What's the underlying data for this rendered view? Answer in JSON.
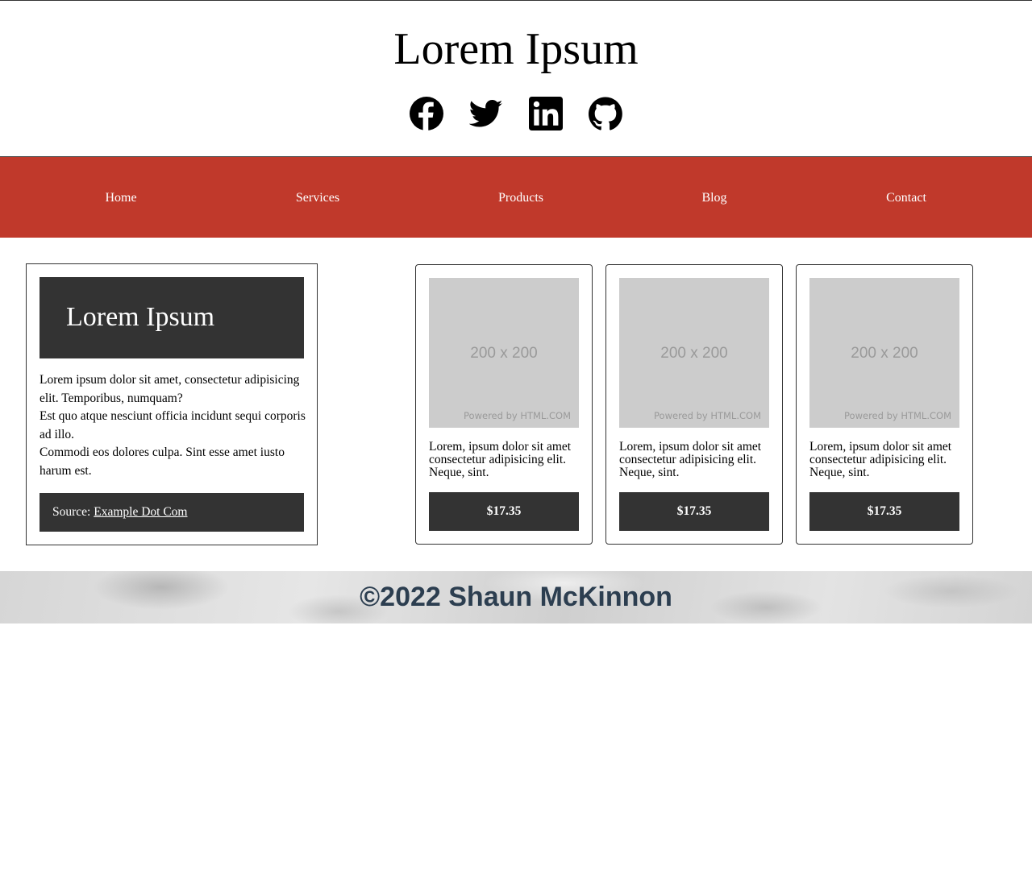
{
  "header": {
    "title": "Lorem Ipsum",
    "social": [
      {
        "name": "facebook-icon"
      },
      {
        "name": "twitter-icon"
      },
      {
        "name": "linkedin-icon"
      },
      {
        "name": "github-icon"
      }
    ]
  },
  "nav": {
    "items": [
      "Home",
      "Services",
      "Products",
      "Blog",
      "Contact"
    ]
  },
  "feature": {
    "title": "Lorem Ipsum",
    "paragraphs": [
      "Lorem ipsum dolor sit amet, consectetur adipisicing elit. Temporibus, numquam?",
      "Est quo atque nesciunt officia incidunt sequi corporis ad illo.",
      "Commodi eos dolores culpa. Sint esse amet iusto harum est."
    ],
    "source_prefix": "Source:",
    "source_link": "Example Dot Com"
  },
  "products": [
    {
      "image_label": "200 x 200",
      "image_credit": "Powered by HTML.COM",
      "description": "Lorem, ipsum dolor sit amet consectetur adipisicing elit. Neque, sint.",
      "price": "$17.35"
    },
    {
      "image_label": "200 x 200",
      "image_credit": "Powered by HTML.COM",
      "description": "Lorem, ipsum dolor sit amet consectetur adipisicing elit. Neque, sint.",
      "price": "$17.35"
    },
    {
      "image_label": "200 x 200",
      "image_credit": "Powered by HTML.COM",
      "description": "Lorem, ipsum dolor sit amet consectetur adipisicing elit. Neque, sint.",
      "price": "$17.35"
    }
  ],
  "footer": {
    "text": "©2022 Shaun McKinnon"
  },
  "colors": {
    "nav_background": "#c0392b",
    "dark_panel": "#333333",
    "footer_text": "#2c3e50",
    "placeholder_bg": "#cccccc"
  }
}
